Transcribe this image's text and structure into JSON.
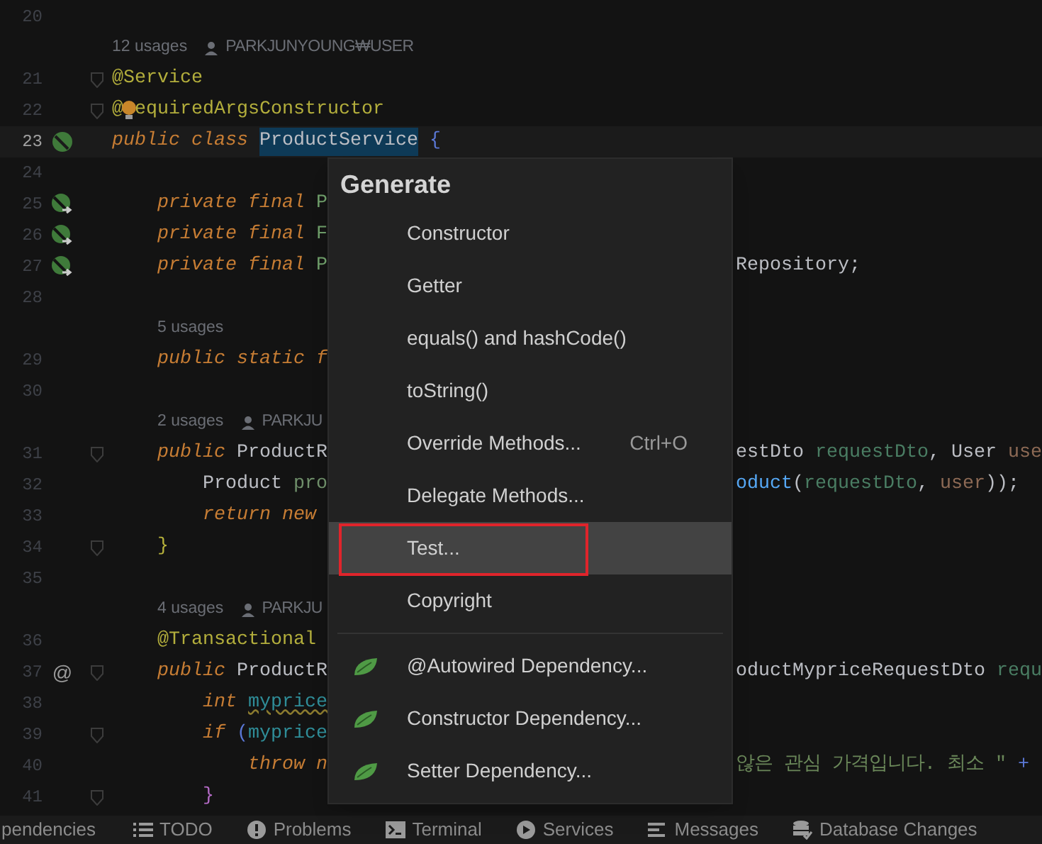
{
  "editor": {
    "lines": [
      {
        "kind": "code",
        "number": "20"
      },
      {
        "kind": "usages",
        "count": "12 usages",
        "author": "PARKJUNYOUNG₩USER"
      },
      {
        "kind": "code",
        "number": "21",
        "fold": true,
        "tokens": [
          {
            "kind": "ann",
            "s": "@Service"
          }
        ]
      },
      {
        "kind": "code",
        "number": "22",
        "fold": true,
        "tokens": [
          {
            "kind": "ann",
            "s": "@"
          },
          {
            "kind": "bulb"
          },
          {
            "kind": "ann",
            "s": "equiredArgsConstructor"
          }
        ]
      },
      {
        "kind": "code",
        "number": "23",
        "current": true,
        "gutter": {
          "kind": "bean"
        },
        "tokens": [
          {
            "kind": "kw",
            "s": "public class "
          },
          {
            "kind": "sel",
            "s": "ProductService"
          },
          {
            "kind": "brace",
            "s": "{"
          }
        ]
      },
      {
        "kind": "code",
        "number": "24"
      },
      {
        "kind": "code",
        "number": "25",
        "gutter": {
          "kind": "injected"
        },
        "tokens": [
          {
            "kind": "kw",
            "s": "    private final "
          },
          {
            "kind": "typegreen",
            "s": "P"
          }
        ]
      },
      {
        "kind": "code",
        "number": "26",
        "gutter": {
          "kind": "injected"
        },
        "tokens": [
          {
            "kind": "kw",
            "s": "    private final "
          },
          {
            "kind": "typegreen",
            "s": "F"
          }
        ]
      },
      {
        "kind": "code",
        "number": "27",
        "gutter": {
          "kind": "injected"
        },
        "tokens": [
          {
            "kind": "kw",
            "s": "    private final "
          },
          {
            "kind": "typegreen",
            "s": "P"
          }
        ],
        "right": [
          {
            "kind": "plain",
            "s": "Repository;"
          }
        ]
      },
      {
        "kind": "code",
        "number": "28"
      },
      {
        "kind": "usages",
        "count": "5 usages"
      },
      {
        "kind": "code",
        "number": "29",
        "tokens": [
          {
            "kind": "kw",
            "s": "    public static f"
          }
        ]
      },
      {
        "kind": "code",
        "number": "30"
      },
      {
        "kind": "usages",
        "count": "2 usages",
        "author": "PARKJU"
      },
      {
        "kind": "code",
        "number": "31",
        "fold": true,
        "tokens": [
          {
            "kind": "kw",
            "s": "    public "
          },
          {
            "kind": "plain",
            "s": "ProductR"
          }
        ],
        "right": [
          {
            "kind": "plain",
            "s": "estDto "
          },
          {
            "kind": "param",
            "s": "requestDto"
          },
          {
            "kind": "plain",
            "s": ", User "
          },
          {
            "kind": "param2",
            "s": "use"
          }
        ]
      },
      {
        "kind": "code",
        "number": "32",
        "tokens": [
          {
            "kind": "plain",
            "s": "        Product "
          },
          {
            "kind": "local",
            "s": "pro"
          }
        ],
        "right": [
          {
            "kind": "method",
            "s": "oduct"
          },
          {
            "kind": "plain",
            "s": "("
          },
          {
            "kind": "param",
            "s": "requestDto"
          },
          {
            "kind": "plain",
            "s": ", "
          },
          {
            "kind": "param2",
            "s": "user"
          },
          {
            "kind": "plain",
            "s": "));"
          }
        ]
      },
      {
        "kind": "code",
        "number": "33",
        "tokens": [
          {
            "kind": "kw",
            "s": "        return new"
          }
        ]
      },
      {
        "kind": "code",
        "number": "34",
        "fold": true,
        "tokens": [
          {
            "kind": "yellow",
            "s": "    }"
          }
        ]
      },
      {
        "kind": "code",
        "number": "35"
      },
      {
        "kind": "usages",
        "count": "4 usages",
        "author": "PARKJU"
      },
      {
        "kind": "code",
        "number": "36",
        "tokens": [
          {
            "kind": "ann",
            "s": "    @Transactional"
          }
        ]
      },
      {
        "kind": "code",
        "number": "37",
        "fold": true,
        "gutter": {
          "kind": "symbol",
          "text": "@"
        },
        "tokens": [
          {
            "kind": "kw",
            "s": "    public "
          },
          {
            "kind": "plain",
            "s": "ProductR"
          }
        ],
        "right": [
          {
            "kind": "plain",
            "s": "oductMypriceRequestDto "
          },
          {
            "kind": "param",
            "s": "requ"
          }
        ]
      },
      {
        "kind": "code",
        "number": "38",
        "tokens": [
          {
            "kind": "kw",
            "s": "        int "
          },
          {
            "kind": "warn",
            "s": "myprice"
          }
        ]
      },
      {
        "kind": "code",
        "number": "39",
        "fold": true,
        "tokens": [
          {
            "kind": "kw",
            "s": "        if "
          },
          {
            "kind": "blue",
            "s": "("
          },
          {
            "kind": "teal",
            "s": "myprice"
          }
        ]
      },
      {
        "kind": "code",
        "number": "40",
        "tokens": [
          {
            "kind": "kw",
            "s": "            throw n"
          }
        ],
        "right": [
          {
            "kind": "str",
            "s": "않은 관심 가격입니다. 최소 \" "
          },
          {
            "kind": "blue",
            "s": "+"
          }
        ]
      },
      {
        "kind": "code",
        "number": "41",
        "fold": true,
        "tokens": [
          {
            "kind": "purple",
            "s": "        }"
          }
        ]
      }
    ]
  },
  "generate_popup": {
    "title": "Generate",
    "groups": [
      [
        {
          "kind": "plain",
          "label": "Constructor",
          "selected": false
        },
        {
          "kind": "plain",
          "label": "Getter",
          "selected": false
        },
        {
          "kind": "plain",
          "label": "equals() and hashCode()",
          "selected": false
        },
        {
          "kind": "plain",
          "label": "toString()",
          "selected": false
        },
        {
          "kind": "plain",
          "label": "Override Methods...",
          "shortcut": "Ctrl+O",
          "selected": false
        },
        {
          "kind": "plain",
          "label": "Delegate Methods...",
          "selected": false
        },
        {
          "kind": "plain",
          "label": "Test...",
          "selected": true,
          "outlined": true
        },
        {
          "kind": "plain",
          "label": "Copyright",
          "selected": false
        }
      ],
      [
        {
          "kind": "spring",
          "label": "@Autowired Dependency...",
          "selected": false
        },
        {
          "kind": "spring",
          "label": "Constructor Dependency...",
          "selected": false
        },
        {
          "kind": "spring",
          "label": "Setter Dependency...",
          "selected": false
        }
      ]
    ]
  },
  "tool_window_bar": [
    {
      "kind": "text",
      "label": "pendencies"
    },
    {
      "kind": "list",
      "label": "TODO"
    },
    {
      "kind": "problems",
      "label": "Problems"
    },
    {
      "kind": "terminal",
      "label": "Terminal"
    },
    {
      "kind": "services",
      "label": "Services"
    },
    {
      "kind": "messages",
      "label": "Messages"
    },
    {
      "kind": "database",
      "label": "Database Changes"
    }
  ]
}
